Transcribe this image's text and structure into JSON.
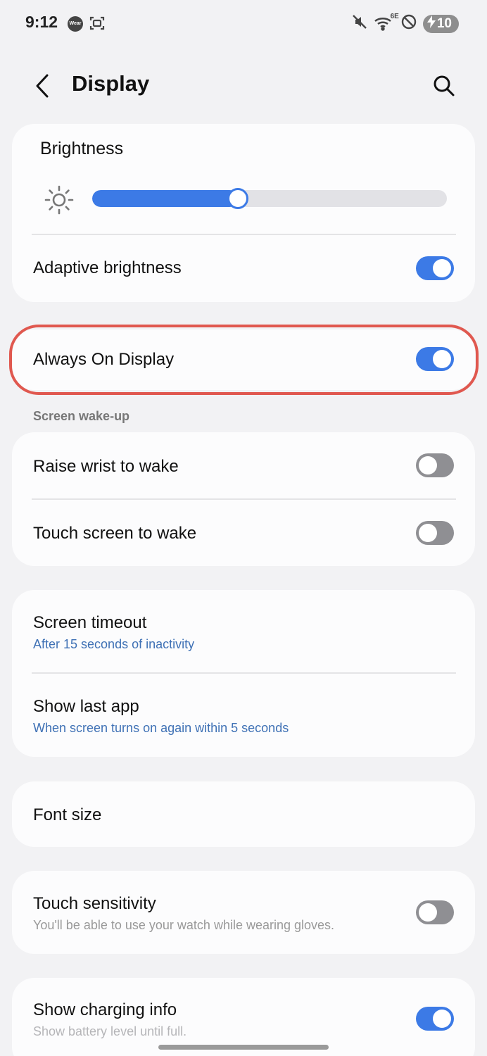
{
  "status_bar": {
    "time": "9:12",
    "wear_badge": "Wear",
    "wifi_label": "6E",
    "battery": "10"
  },
  "header": {
    "title": "Display"
  },
  "brightness": {
    "label": "Brightness",
    "level": 0.41
  },
  "adaptive_brightness": {
    "label": "Adaptive brightness",
    "on": true
  },
  "always_on_display": {
    "label": "Always On Display",
    "on": true
  },
  "screen_wakeup": {
    "section_label": "Screen wake-up",
    "raise_wrist": {
      "label": "Raise wrist to wake",
      "on": false
    },
    "touch_screen": {
      "label": "Touch screen to wake",
      "on": false
    }
  },
  "screen_timeout": {
    "label": "Screen timeout",
    "value": "After 15 seconds of inactivity"
  },
  "show_last_app": {
    "label": "Show last app",
    "value": "When screen turns on again within 5 seconds"
  },
  "font_size": {
    "label": "Font size"
  },
  "touch_sensitivity": {
    "label": "Touch sensitivity",
    "description": "You'll be able to use your watch while wearing gloves.",
    "on": false
  },
  "charging_info": {
    "label": "Show charging info",
    "description": "Show battery level until full.",
    "on": true
  },
  "colors": {
    "accent": "#3c7ae6",
    "highlight": "#e0584f",
    "subtitle_blue": "#3f71b5"
  }
}
